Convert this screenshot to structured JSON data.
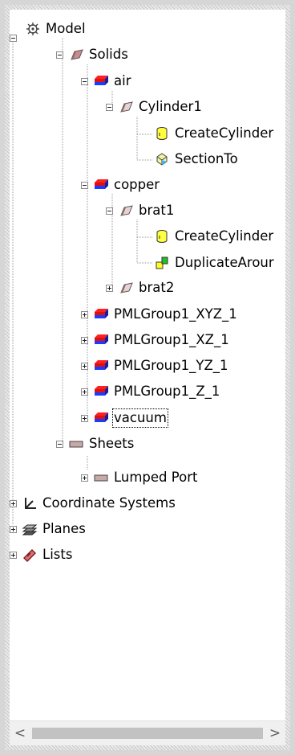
{
  "tree": {
    "model": {
      "label": "Model",
      "icon": "model-icon"
    },
    "solids": {
      "label": "Solids",
      "icon": "solids-folder-icon"
    },
    "air": {
      "label": "air",
      "icon": "material-icon"
    },
    "cylinder1": {
      "label": "Cylinder1",
      "icon": "solid-part-icon"
    },
    "create_cylinder_1": {
      "label": "CreateCylinder",
      "icon": "create-cylinder-icon"
    },
    "section_to": {
      "label": "SectionTo",
      "icon": "section-icon"
    },
    "copper": {
      "label": "copper",
      "icon": "material-icon"
    },
    "brat1": {
      "label": "brat1",
      "icon": "solid-part-icon"
    },
    "create_cylinder_2": {
      "label": "CreateCylinder",
      "icon": "create-cylinder-icon"
    },
    "duplicate_around": {
      "label": "DuplicateArour",
      "icon": "duplicate-icon"
    },
    "brat2": {
      "label": "brat2",
      "icon": "solid-part-icon"
    },
    "pml_xyz": {
      "label": "PMLGroup1_XYZ_1",
      "icon": "material-icon"
    },
    "pml_xz": {
      "label": "PMLGroup1_XZ_1",
      "icon": "material-icon"
    },
    "pml_yz": {
      "label": "PMLGroup1_YZ_1",
      "icon": "material-icon"
    },
    "pml_z": {
      "label": "PMLGroup1_Z_1",
      "icon": "material-icon"
    },
    "vacuum": {
      "label": "vacuum",
      "icon": "material-icon"
    },
    "sheets": {
      "label": "Sheets",
      "icon": "sheet-icon"
    },
    "lumped_port": {
      "label": "Lumped Port",
      "icon": "sheet-icon"
    },
    "coordinate_systems": {
      "label": "Coordinate Systems",
      "icon": "coordinate-system-icon"
    },
    "planes": {
      "label": "Planes",
      "icon": "planes-icon"
    },
    "lists": {
      "label": "Lists",
      "icon": "lists-icon"
    }
  },
  "scrollbar": {
    "left_arrow": "<",
    "right_arrow": ">"
  }
}
